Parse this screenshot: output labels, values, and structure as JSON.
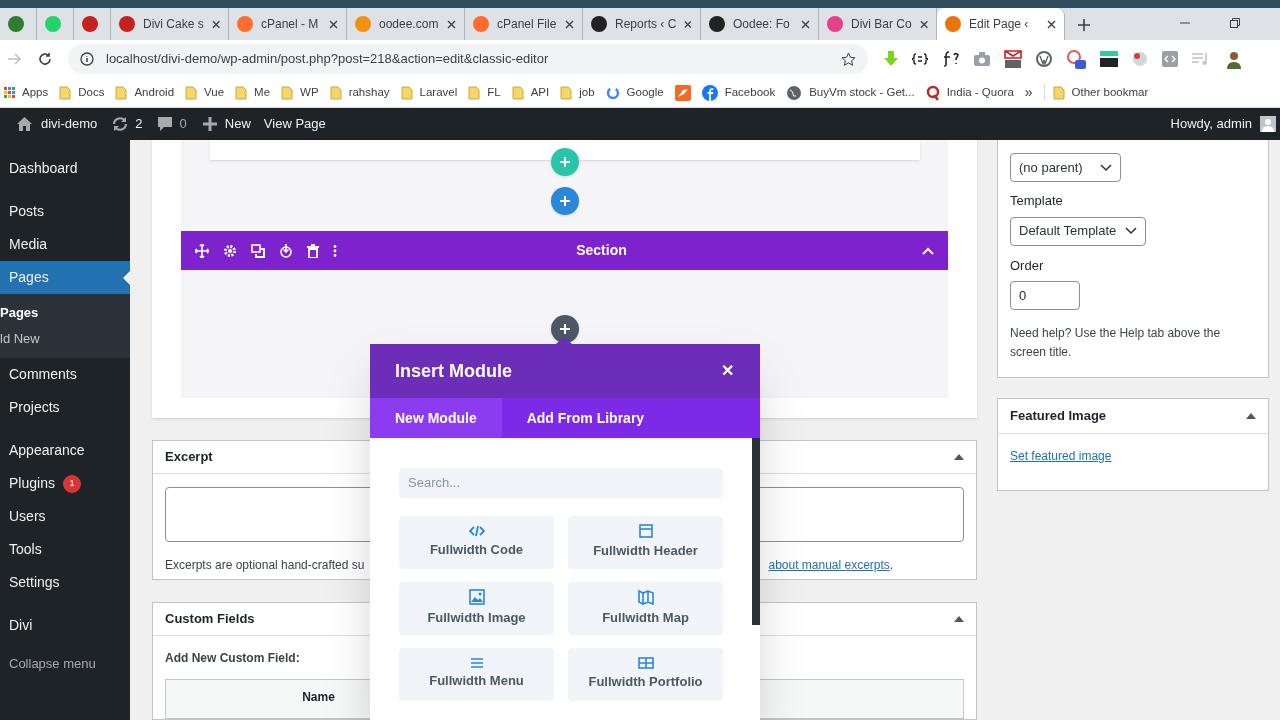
{
  "browser": {
    "tabs": [
      {
        "color": "#2e7d32",
        "selected": false
      },
      {
        "color": "#25d366",
        "selected": false
      },
      {
        "color": "#c5221f",
        "selected": false
      },
      {
        "label": "Divi Cake s",
        "color": "#c5221f",
        "selected": false
      },
      {
        "label": "cPanel - M",
        "color": "#ff6c2c",
        "selected": false
      },
      {
        "label": "oodee.com",
        "color": "#f29111",
        "selected": false
      },
      {
        "label": "cPanel File",
        "color": "#ff6c2c",
        "selected": false
      },
      {
        "label": "Reports ‹ C",
        "color": "#222222",
        "selected": false
      },
      {
        "label": "Oodee: Fo",
        "color": "#222222",
        "selected": false
      },
      {
        "label": "Divi Bar Co",
        "color": "#e83e8c",
        "selected": false
      },
      {
        "label": "Edit Page ‹",
        "color": "#e8740c",
        "selected": true
      }
    ],
    "address": "localhost/divi-demo/wp-admin/post.php?post=218&action=edit&classic-editor",
    "bookmarks": [
      {
        "label": "Apps",
        "kind": "apps"
      },
      {
        "label": "Docs",
        "kind": "folder"
      },
      {
        "label": "Android",
        "kind": "folder"
      },
      {
        "label": "Vue",
        "kind": "folder"
      },
      {
        "label": "Me",
        "kind": "folder"
      },
      {
        "label": "WP",
        "kind": "folder"
      },
      {
        "label": "rahshay",
        "kind": "folder"
      },
      {
        "label": "Laravel",
        "kind": "folder"
      },
      {
        "label": "FL",
        "kind": "folder"
      },
      {
        "label": "API",
        "kind": "folder"
      },
      {
        "label": "job",
        "kind": "folder"
      },
      {
        "label": "Google",
        "kind": "google"
      },
      {
        "kind": "orange"
      },
      {
        "label": "Facebook",
        "kind": "facebook"
      },
      {
        "label": "BuyVm stock - Get...",
        "kind": "globe"
      },
      {
        "label": "India - Quora",
        "kind": "quora"
      }
    ],
    "more": "»",
    "other_bookmarks": "Other bookmar"
  },
  "admin_bar": {
    "site": "divi-demo",
    "updates": "2",
    "comments": "0",
    "new": "New",
    "view": "View Page",
    "greeting": "Howdy, admin"
  },
  "sidebar": {
    "groups": [
      [
        {
          "label": "Dashboard",
          "selected": false
        }
      ],
      [
        {
          "label": "Posts",
          "selected": false
        },
        {
          "label": "Media",
          "selected": false
        },
        {
          "label": "Pages",
          "selected": true,
          "children": [
            {
              "label": "Pages",
              "selected": true
            },
            {
              "label": "ld New",
              "selected": false
            }
          ]
        },
        {
          "label": "Comments",
          "selected": false
        },
        {
          "label": "Projects",
          "selected": false
        }
      ],
      [
        {
          "label": "Appearance",
          "selected": false
        },
        {
          "label": "Plugins",
          "selected": false,
          "badge": "1"
        },
        {
          "label": "Users",
          "selected": false
        },
        {
          "label": "Tools",
          "selected": false
        },
        {
          "label": "Settings",
          "selected": false
        }
      ],
      [
        {
          "label": "Divi",
          "selected": false
        }
      ]
    ],
    "collapse": "Collapse menu"
  },
  "builder": {
    "section_title": "Section"
  },
  "modal": {
    "title": "Insert Module",
    "close": "✕",
    "tabs": [
      {
        "label": "New Module",
        "selected": true
      },
      {
        "label": "Add From Library",
        "selected": false
      }
    ],
    "search": {
      "placeholder": "Search..."
    },
    "modules": [
      {
        "label": "Fullwidth Code",
        "kind": "code"
      },
      {
        "label": "Fullwidth Header",
        "kind": "header"
      },
      {
        "label": "Fullwidth Image",
        "kind": "image"
      },
      {
        "label": "Fullwidth Map",
        "kind": "map"
      },
      {
        "label": "Fullwidth Menu",
        "kind": "menu"
      },
      {
        "label": "Fullwidth Portfolio",
        "kind": "portfolio"
      }
    ]
  },
  "excerpt": {
    "title": "Excerpt",
    "help": "Excerpts are optional hand-crafted su",
    "link": "about manual excerpts",
    "end": "."
  },
  "custom_fields": {
    "title": "Custom Fields",
    "add_label": "Add New Custom Field:",
    "column": "Name"
  },
  "attributes": {
    "parent": "(no parent)",
    "template_label": "Template",
    "template": "Default Template",
    "order_label": "Order",
    "order": "0",
    "help": "Need help? Use the Help tab above the screen title."
  },
  "featured_image": {
    "title": "Featured Image",
    "link": "Set featured image"
  }
}
